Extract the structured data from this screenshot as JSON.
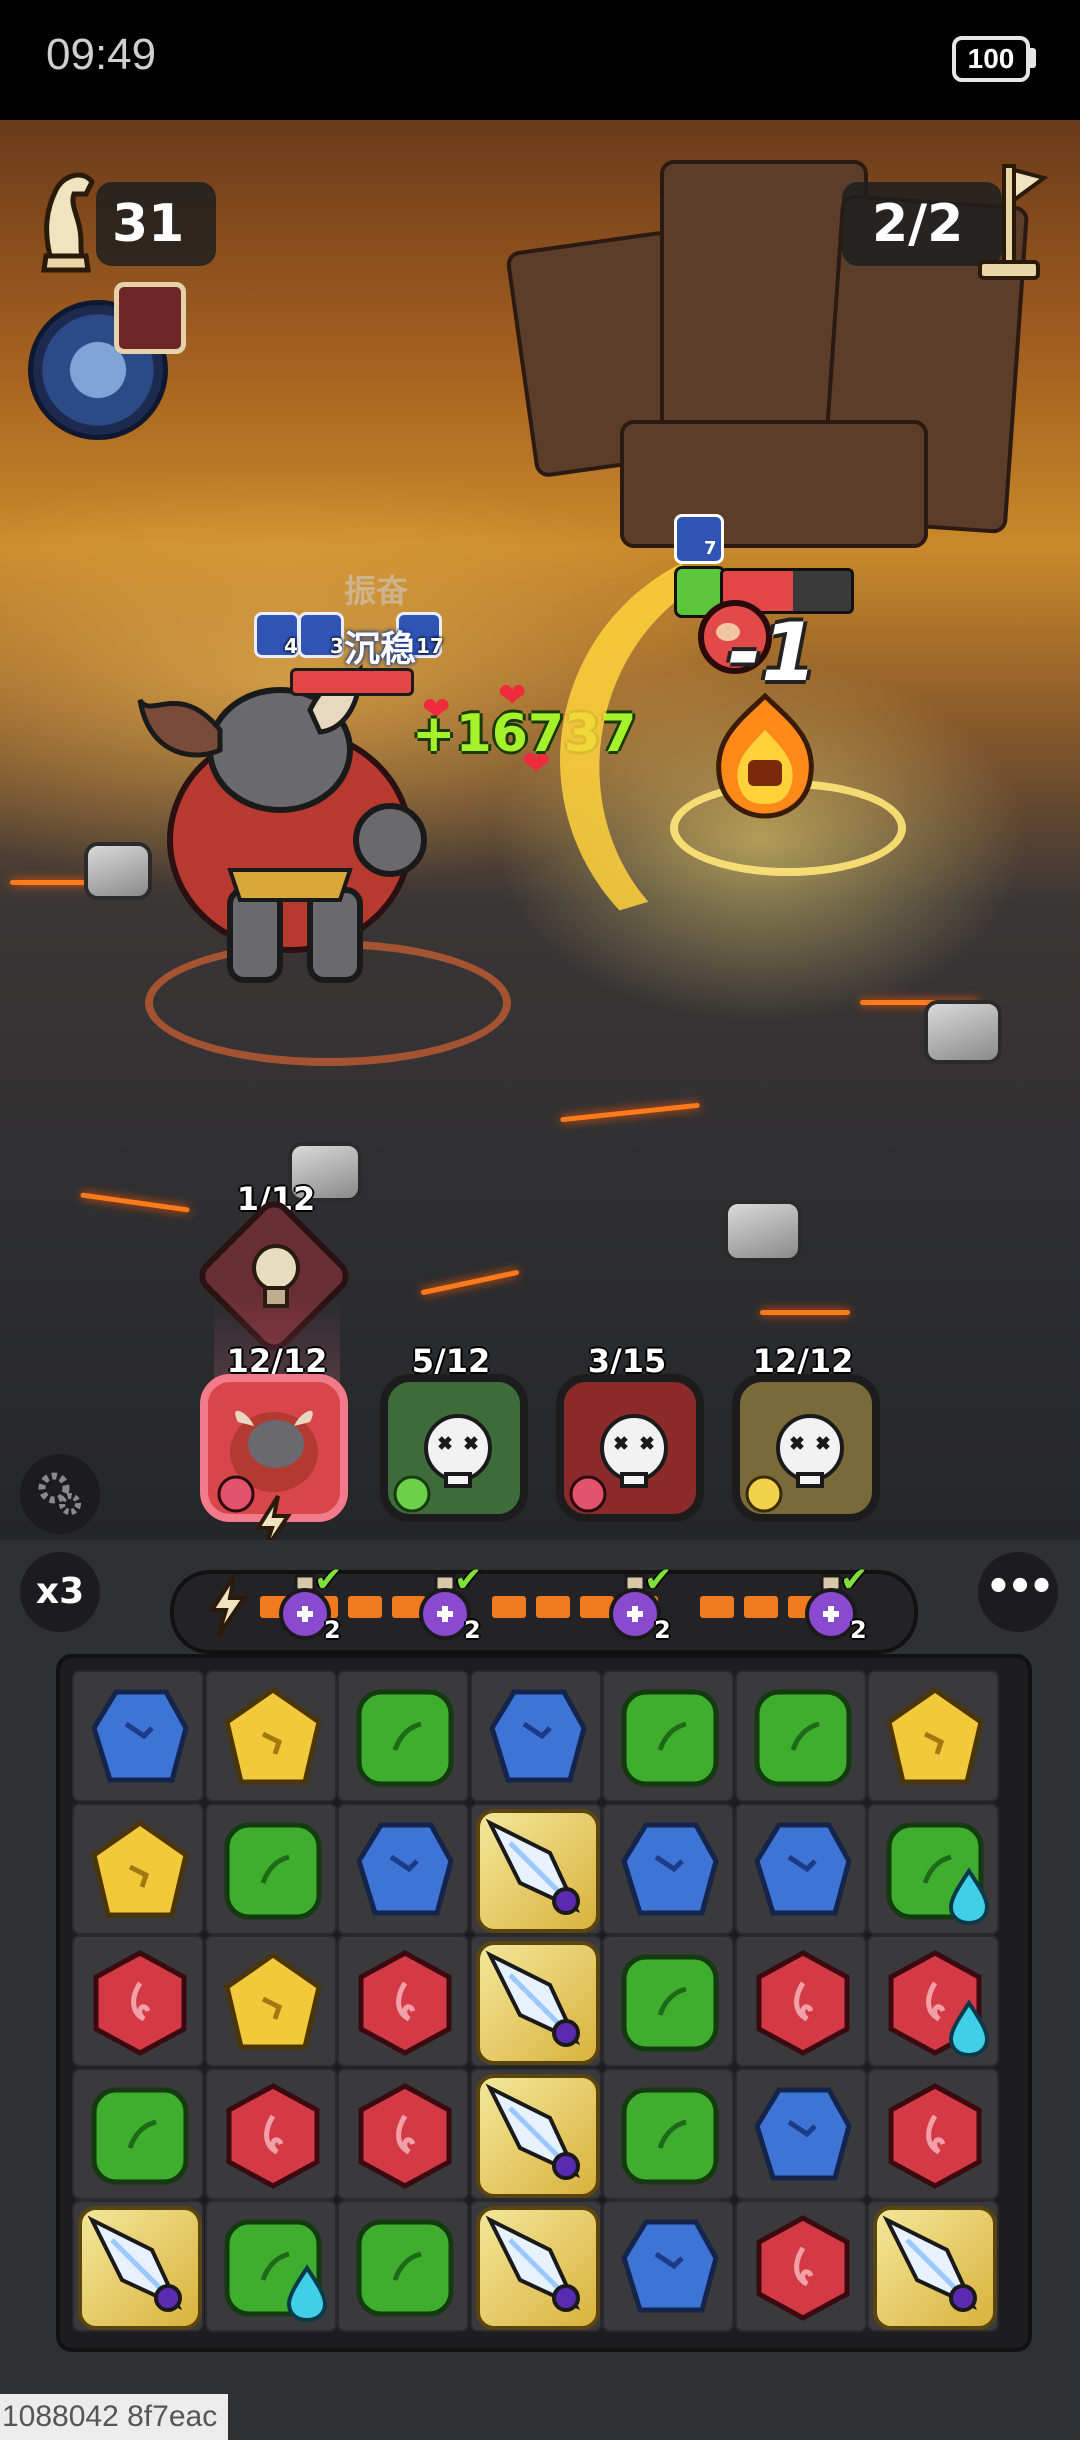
{
  "status_bar": {
    "time": "09:49",
    "battery": "100"
  },
  "hud": {
    "moves_left": "31",
    "wave": "2/2"
  },
  "player_unit": {
    "buffs": [
      {
        "icon": "shield-break-icon",
        "count": "4"
      },
      {
        "icon": "dodge-icon",
        "count": "3"
      },
      {
        "icon": "ally-icon",
        "count": "17"
      }
    ],
    "status_text": "沉稳",
    "status_faded": "振奋",
    "heal": "+16737"
  },
  "enemy_unit": {
    "buff_count": "7",
    "damage": "-1",
    "hp_fraction": 0.55
  },
  "skill": {
    "charge": "1/12"
  },
  "heroes": [
    {
      "count": "12/12",
      "state": "active",
      "element": "fire",
      "color": "#d9464a"
    },
    {
      "count": "5/12",
      "state": "dead",
      "element": "wind",
      "color": "#3d6b3a"
    },
    {
      "count": "3/15",
      "state": "dead",
      "element": "fire",
      "color": "#8a2a2a"
    },
    {
      "count": "12/12",
      "state": "dead",
      "element": "light",
      "color": "#7a6a3a"
    }
  ],
  "controls": {
    "speed": "x3",
    "more": "•••"
  },
  "potions": [
    {
      "count": "2"
    },
    {
      "count": "2"
    },
    {
      "count": "2"
    },
    {
      "count": "2"
    }
  ],
  "board": {
    "rows": [
      [
        "blue",
        "yellow",
        "green",
        "blue",
        "green",
        "green",
        "yellow"
      ],
      [
        "yellow",
        "green",
        "blue",
        "sword",
        "blue",
        "blue",
        "green+drop"
      ],
      [
        "red",
        "yellow",
        "red",
        "sword",
        "green",
        "red",
        "red+drop"
      ],
      [
        "green",
        "red",
        "red",
        "sword",
        "green",
        "blue",
        "red"
      ],
      [
        "sword",
        "green+drop",
        "green",
        "sword",
        "blue",
        "red",
        "sword"
      ]
    ],
    "colors": {
      "blue": "#3e74d6",
      "yellow": "#f2c93a",
      "green": "#3fae2e",
      "red": "#d33a45"
    }
  },
  "build_id": "1088042 8f7eac"
}
